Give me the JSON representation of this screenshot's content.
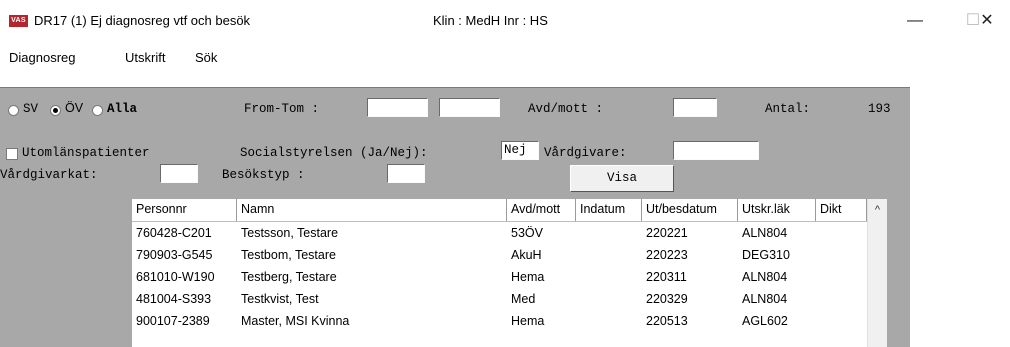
{
  "window": {
    "icon_text": "VAS",
    "title": "DR17 (1) Ej diagnosreg vtf och besök",
    "context": "Klin : MedH  Inr : HS",
    "minimize": "—",
    "maximize": "☐",
    "close": "✕"
  },
  "menu": [
    "Diagnosreg",
    "Utskrift",
    "Sök"
  ],
  "form": {
    "radio_sv": "SV",
    "radio_ov": "ÖV",
    "radio_alla": "Alla",
    "selected_radio": "ÖV",
    "from_tom_label": "From-Tom    :",
    "from_value": "",
    "tom_value": "",
    "avd_mott_label": "Avd/mott    :",
    "avd_mott_value": "",
    "antal_label": "Antal:",
    "antal_value": "193",
    "utomlans_label": "Utomlänspatienter",
    "utomlans_checked": false,
    "socialstyrelsen_label": "Socialstyrelsen (Ja/Nej):",
    "socialstyrelsen_value": "Nej",
    "vardgivare_label": "Vårdgivare:",
    "vardgivare_value": "",
    "vardgivarkat_label": "Vårdgivarkat:",
    "vardgivarkat_value": "",
    "besokstyp_label": "Besökstyp    :",
    "besokstyp_value": "",
    "visa_button": "Visa"
  },
  "table": {
    "columns": [
      "Personnr",
      "Namn",
      "Avd/mott",
      "Indatum",
      "Ut/besdatum",
      "Utskr.läk",
      "Dikt"
    ],
    "rows": [
      [
        "760428-C201",
        "Testsson, Testare",
        "53ÖV",
        "",
        "220221",
        "ALN804",
        ""
      ],
      [
        "790903-G545",
        "Testbom, Testare",
        "AkuH",
        "",
        "220223",
        "DEG310",
        ""
      ],
      [
        "681010-W190",
        "Testberg, Testare",
        "Hema",
        "",
        "220311",
        "ALN804",
        ""
      ],
      [
        "481004-S393",
        "Testkvist, Test",
        "Med",
        "",
        "220329",
        "ALN804",
        ""
      ],
      [
        "900107-2389",
        "Master, MSI Kvinna",
        "Hema",
        "",
        "220513",
        "AGL602",
        ""
      ]
    ]
  },
  "colors": {
    "panel_bg": "#a8a8a8",
    "icon_bg": "#b3262d"
  },
  "icons": {
    "scroll_up": "▲"
  }
}
